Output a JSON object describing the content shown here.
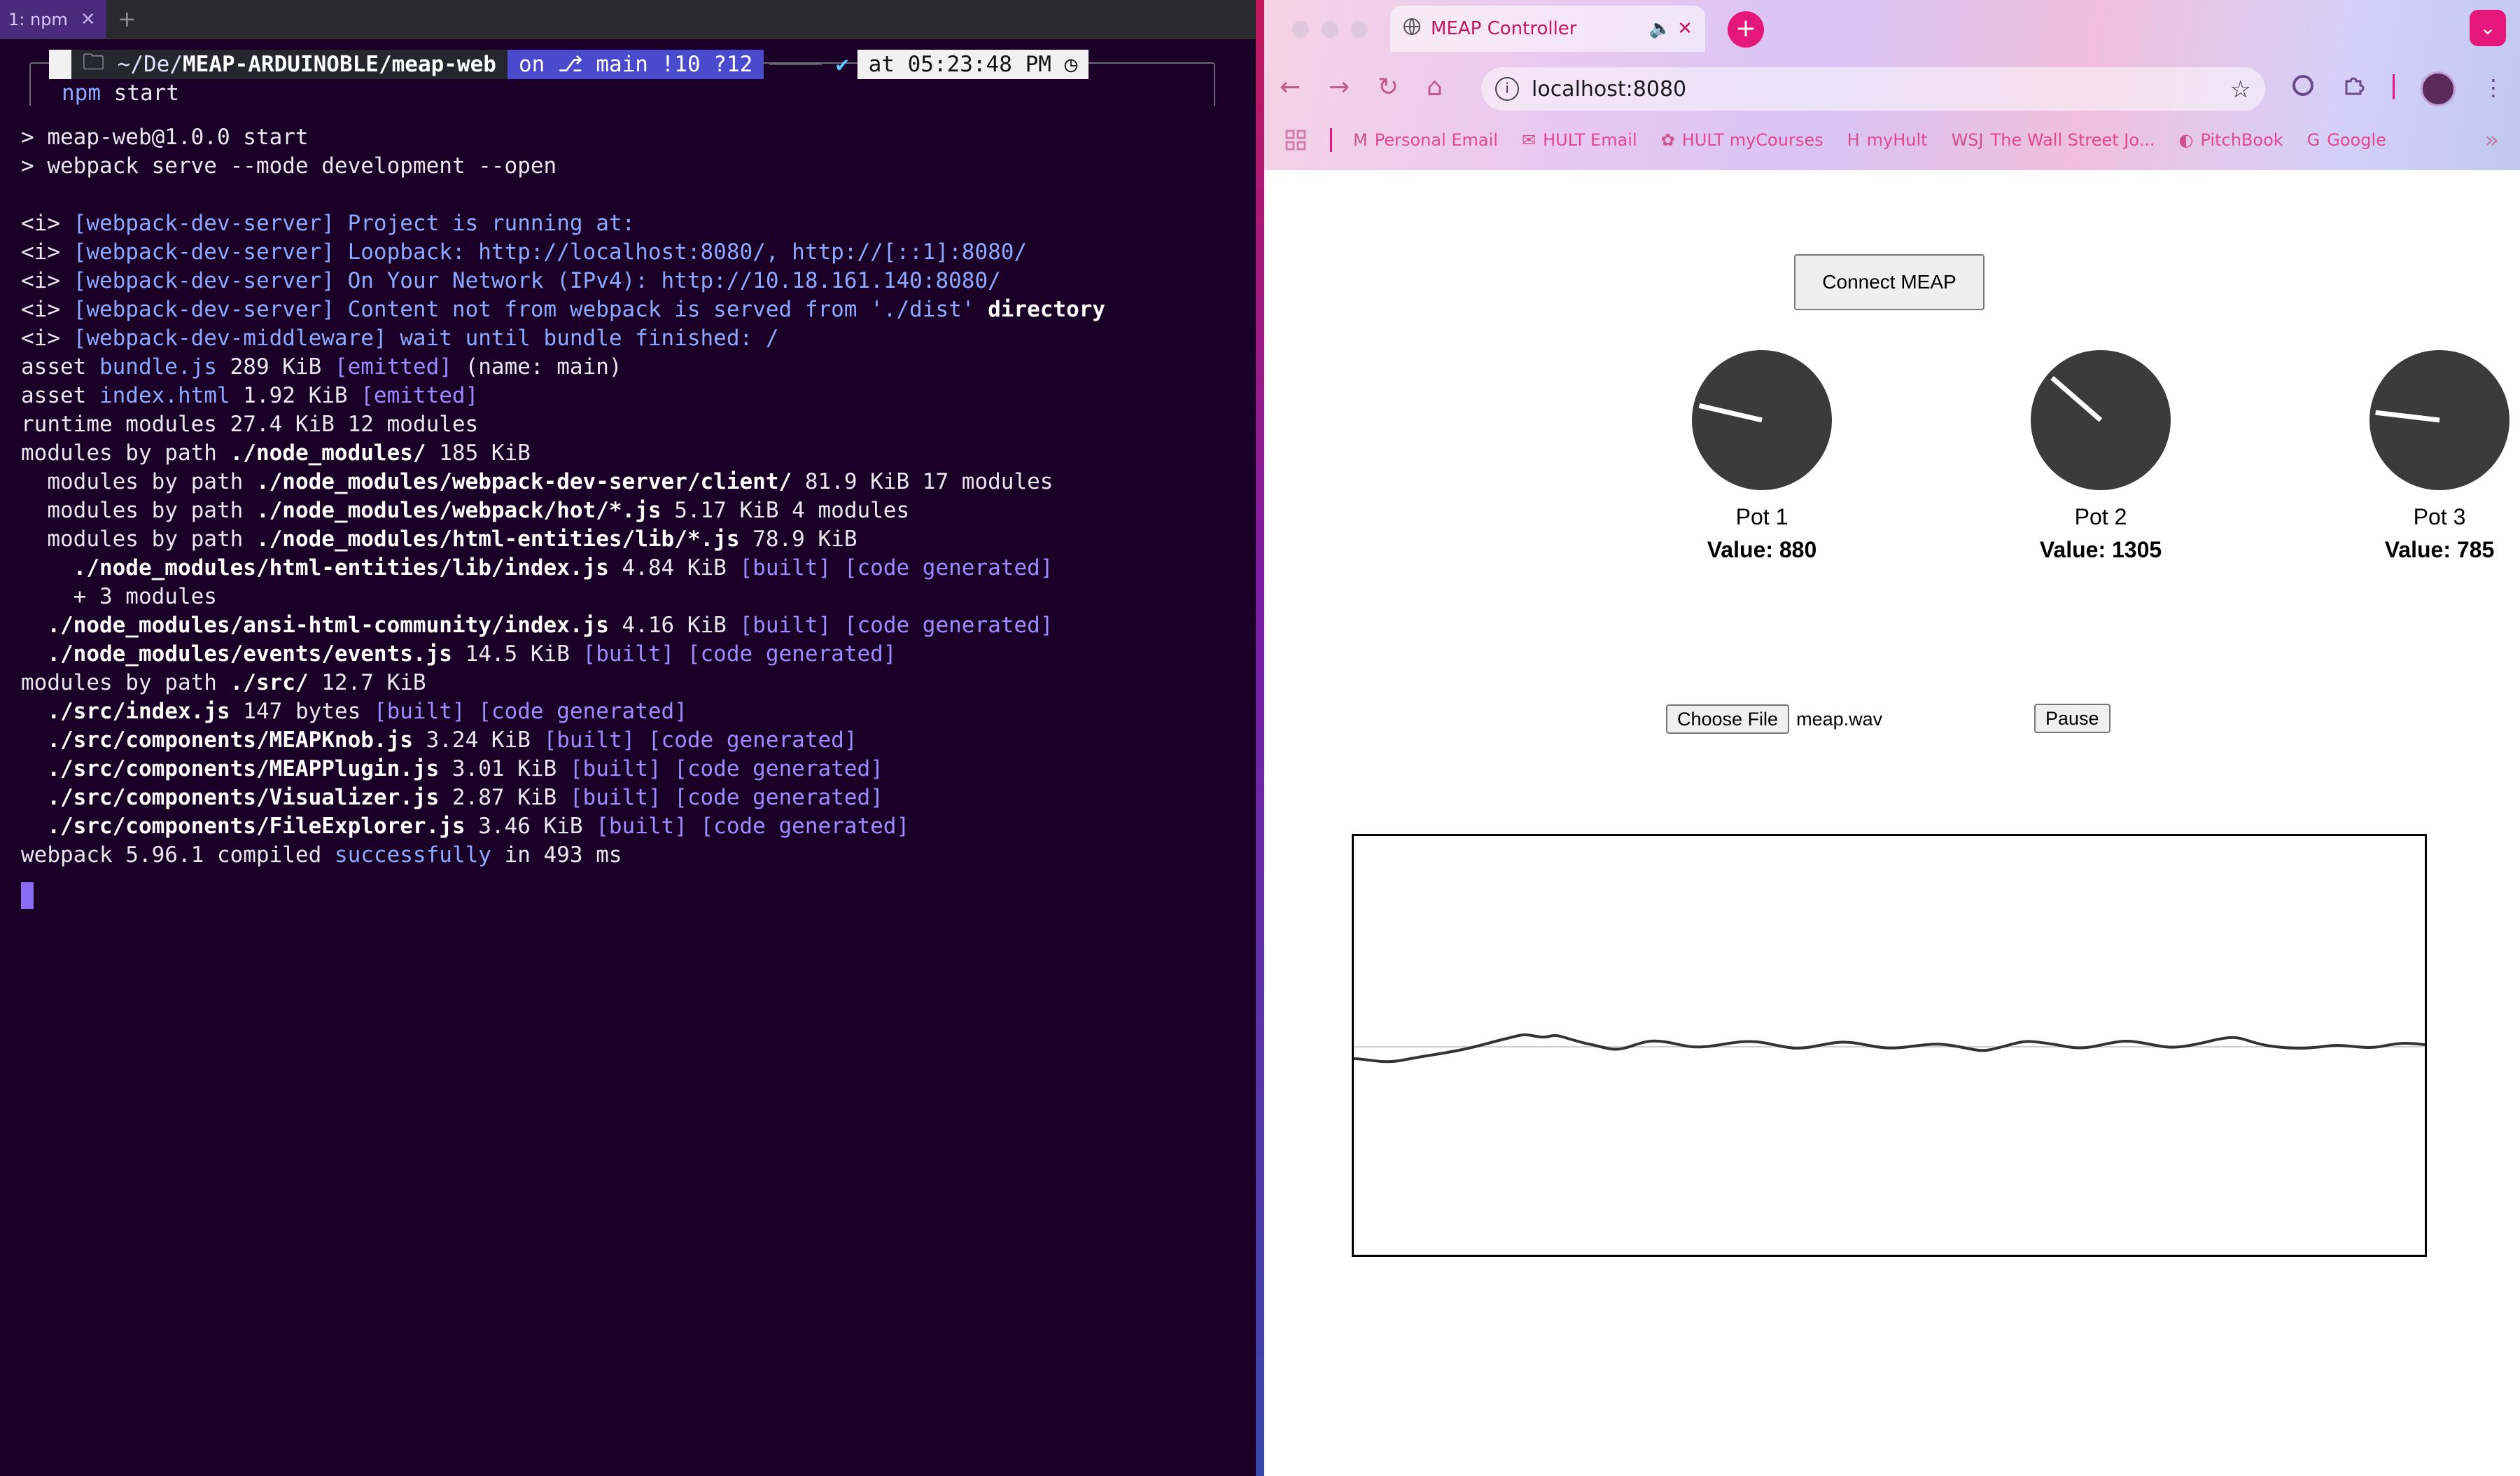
{
  "terminal": {
    "tab_label": "1: npm",
    "tab_close": "✕",
    "new_tab": "+",
    "prompt": {
      "os_glyph": "",
      "path_prefix": "~/De/",
      "path_bold": "MEAP-ARDUINOBLE/meap-web",
      "git": "on ⎇ main !10 ?12",
      "check": "✔",
      "time": "at 05:23:48 PM ◷"
    },
    "command_parts": [
      "npm",
      " start"
    ],
    "lines": [
      [
        {
          "t": "> meap-web@1.0.0 start",
          "c": "grey"
        }
      ],
      [
        {
          "t": "> webpack serve --mode development --open",
          "c": "grey"
        }
      ],
      [
        {
          "t": "",
          "c": "grey"
        }
      ],
      [
        {
          "t": "<i> ",
          "c": "grey"
        },
        {
          "t": "[webpack-dev-server] Project is running at:",
          "c": "blue"
        }
      ],
      [
        {
          "t": "<i> ",
          "c": "grey"
        },
        {
          "t": "[webpack-dev-server] Loopback: http://localhost:8080/, http://[::1]:8080/",
          "c": "blue"
        }
      ],
      [
        {
          "t": "<i> ",
          "c": "grey"
        },
        {
          "t": "[webpack-dev-server] On Your Network (IPv4): http://10.18.161.140:8080/",
          "c": "blue"
        }
      ],
      [
        {
          "t": "<i> ",
          "c": "grey"
        },
        {
          "t": "[webpack-dev-server] Content not from webpack is served from './dist' ",
          "c": "blue"
        },
        {
          "t": "directory",
          "c": "white-b"
        }
      ],
      [
        {
          "t": "<i> ",
          "c": "grey"
        },
        {
          "t": "[webpack-dev-middleware] wait until bundle finished: /",
          "c": "blue"
        }
      ],
      [
        {
          "t": "asset ",
          "c": "grey"
        },
        {
          "t": "bundle.js",
          "c": "blue"
        },
        {
          "t": " 289 KiB ",
          "c": "grey"
        },
        {
          "t": "[emitted]",
          "c": "lav"
        },
        {
          "t": " (name: main)",
          "c": "grey"
        }
      ],
      [
        {
          "t": "asset ",
          "c": "grey"
        },
        {
          "t": "index.html",
          "c": "blue"
        },
        {
          "t": " 1.92 KiB ",
          "c": "grey"
        },
        {
          "t": "[emitted]",
          "c": "lav"
        }
      ],
      [
        {
          "t": "runtime modules 27.4 KiB 12 modules",
          "c": "grey"
        }
      ],
      [
        {
          "t": "modules by path ",
          "c": "grey"
        },
        {
          "t": "./node_modules/",
          "c": "white-b"
        },
        {
          "t": " 185 KiB",
          "c": "grey"
        }
      ],
      [
        {
          "t": "  modules by path ",
          "c": "grey"
        },
        {
          "t": "./node_modules/webpack-dev-server/client/",
          "c": "white-b"
        },
        {
          "t": " 81.9 KiB 17 modules",
          "c": "grey"
        }
      ],
      [
        {
          "t": "  modules by path ",
          "c": "grey"
        },
        {
          "t": "./node_modules/webpack/hot/*.js",
          "c": "white-b"
        },
        {
          "t": " 5.17 KiB 4 modules",
          "c": "grey"
        }
      ],
      [
        {
          "t": "  modules by path ",
          "c": "grey"
        },
        {
          "t": "./node_modules/html-entities/lib/*.js",
          "c": "white-b"
        },
        {
          "t": " 78.9 KiB",
          "c": "grey"
        }
      ],
      [
        {
          "t": "    ./node_modules/html-entities/lib/index.js",
          "c": "white-b"
        },
        {
          "t": " 4.84 KiB ",
          "c": "grey"
        },
        {
          "t": "[built] [code generated]",
          "c": "lav"
        }
      ],
      [
        {
          "t": "    + 3 modules",
          "c": "grey"
        }
      ],
      [
        {
          "t": "  ./node_modules/ansi-html-community/index.js",
          "c": "white-b"
        },
        {
          "t": " 4.16 KiB ",
          "c": "grey"
        },
        {
          "t": "[built] [code generated]",
          "c": "lav"
        }
      ],
      [
        {
          "t": "  ./node_modules/events/events.js",
          "c": "white-b"
        },
        {
          "t": " 14.5 KiB ",
          "c": "grey"
        },
        {
          "t": "[built] [code generated]",
          "c": "lav"
        }
      ],
      [
        {
          "t": "modules by path ",
          "c": "grey"
        },
        {
          "t": "./src/",
          "c": "white-b"
        },
        {
          "t": " 12.7 KiB",
          "c": "grey"
        }
      ],
      [
        {
          "t": "  ./src/index.js",
          "c": "white-b"
        },
        {
          "t": " 147 bytes ",
          "c": "grey"
        },
        {
          "t": "[built] [code generated]",
          "c": "lav"
        }
      ],
      [
        {
          "t": "  ./src/components/MEAPKnob.js",
          "c": "white-b"
        },
        {
          "t": " 3.24 KiB ",
          "c": "grey"
        },
        {
          "t": "[built] [code generated]",
          "c": "lav"
        }
      ],
      [
        {
          "t": "  ./src/components/MEAPPlugin.js",
          "c": "white-b"
        },
        {
          "t": " 3.01 KiB ",
          "c": "grey"
        },
        {
          "t": "[built] [code generated]",
          "c": "lav"
        }
      ],
      [
        {
          "t": "  ./src/components/Visualizer.js",
          "c": "white-b"
        },
        {
          "t": " 2.87 KiB ",
          "c": "grey"
        },
        {
          "t": "[built] [code generated]",
          "c": "lav"
        }
      ],
      [
        {
          "t": "  ./src/components/FileExplorer.js",
          "c": "white-b"
        },
        {
          "t": " 3.46 KiB ",
          "c": "grey"
        },
        {
          "t": "[built] [code generated]",
          "c": "lav"
        }
      ],
      [
        {
          "t": "webpack 5.96.1 compiled ",
          "c": "grey"
        },
        {
          "t": "successfully",
          "c": "green"
        },
        {
          "t": " in 493 ms",
          "c": "grey"
        }
      ]
    ]
  },
  "browser": {
    "tab_title": "MEAP Controller",
    "tab_audio_icon": "🔈",
    "tab_close": "✕",
    "new_tab": "+",
    "tab_menu": "⌄",
    "nav": {
      "back": "←",
      "forward": "→",
      "reload": "↻",
      "home": "⌂"
    },
    "url": "localhost:8080",
    "info_icon": "i",
    "star_icon": "☆",
    "bookmarks": [
      {
        "icon": "M",
        "label": "Personal Email"
      },
      {
        "icon": "✉",
        "label": "HULT Email"
      },
      {
        "icon": "✿",
        "label": "HULT myCourses"
      },
      {
        "icon": "H",
        "label": "myHult"
      },
      {
        "icon": "WSJ",
        "label": "The Wall Street Jo..."
      },
      {
        "icon": "◐",
        "label": "PitchBook"
      },
      {
        "icon": "G",
        "label": "Google"
      }
    ],
    "bookmarks_more": "»"
  },
  "page": {
    "connect_label": "Connect MEAP",
    "knobs": [
      {
        "label": "Pot 1",
        "value_text": "Value: 880",
        "value": 880
      },
      {
        "label": "Pot 2",
        "value_text": "Value: 1305",
        "value": 1305
      },
      {
        "label": "Pot 3",
        "value_text": "Value: 785",
        "value": 785
      }
    ],
    "choose_file_label": "Choose File",
    "file_name": "meap.wav",
    "pause_label": "Pause"
  },
  "colors": {
    "terminal_bg": "#1a0027",
    "knob_fill": "#3b3b3b",
    "accent_pink": "#e5177a",
    "link_blue": "#8fa8ff",
    "built_lavender": "#9b8cff"
  }
}
